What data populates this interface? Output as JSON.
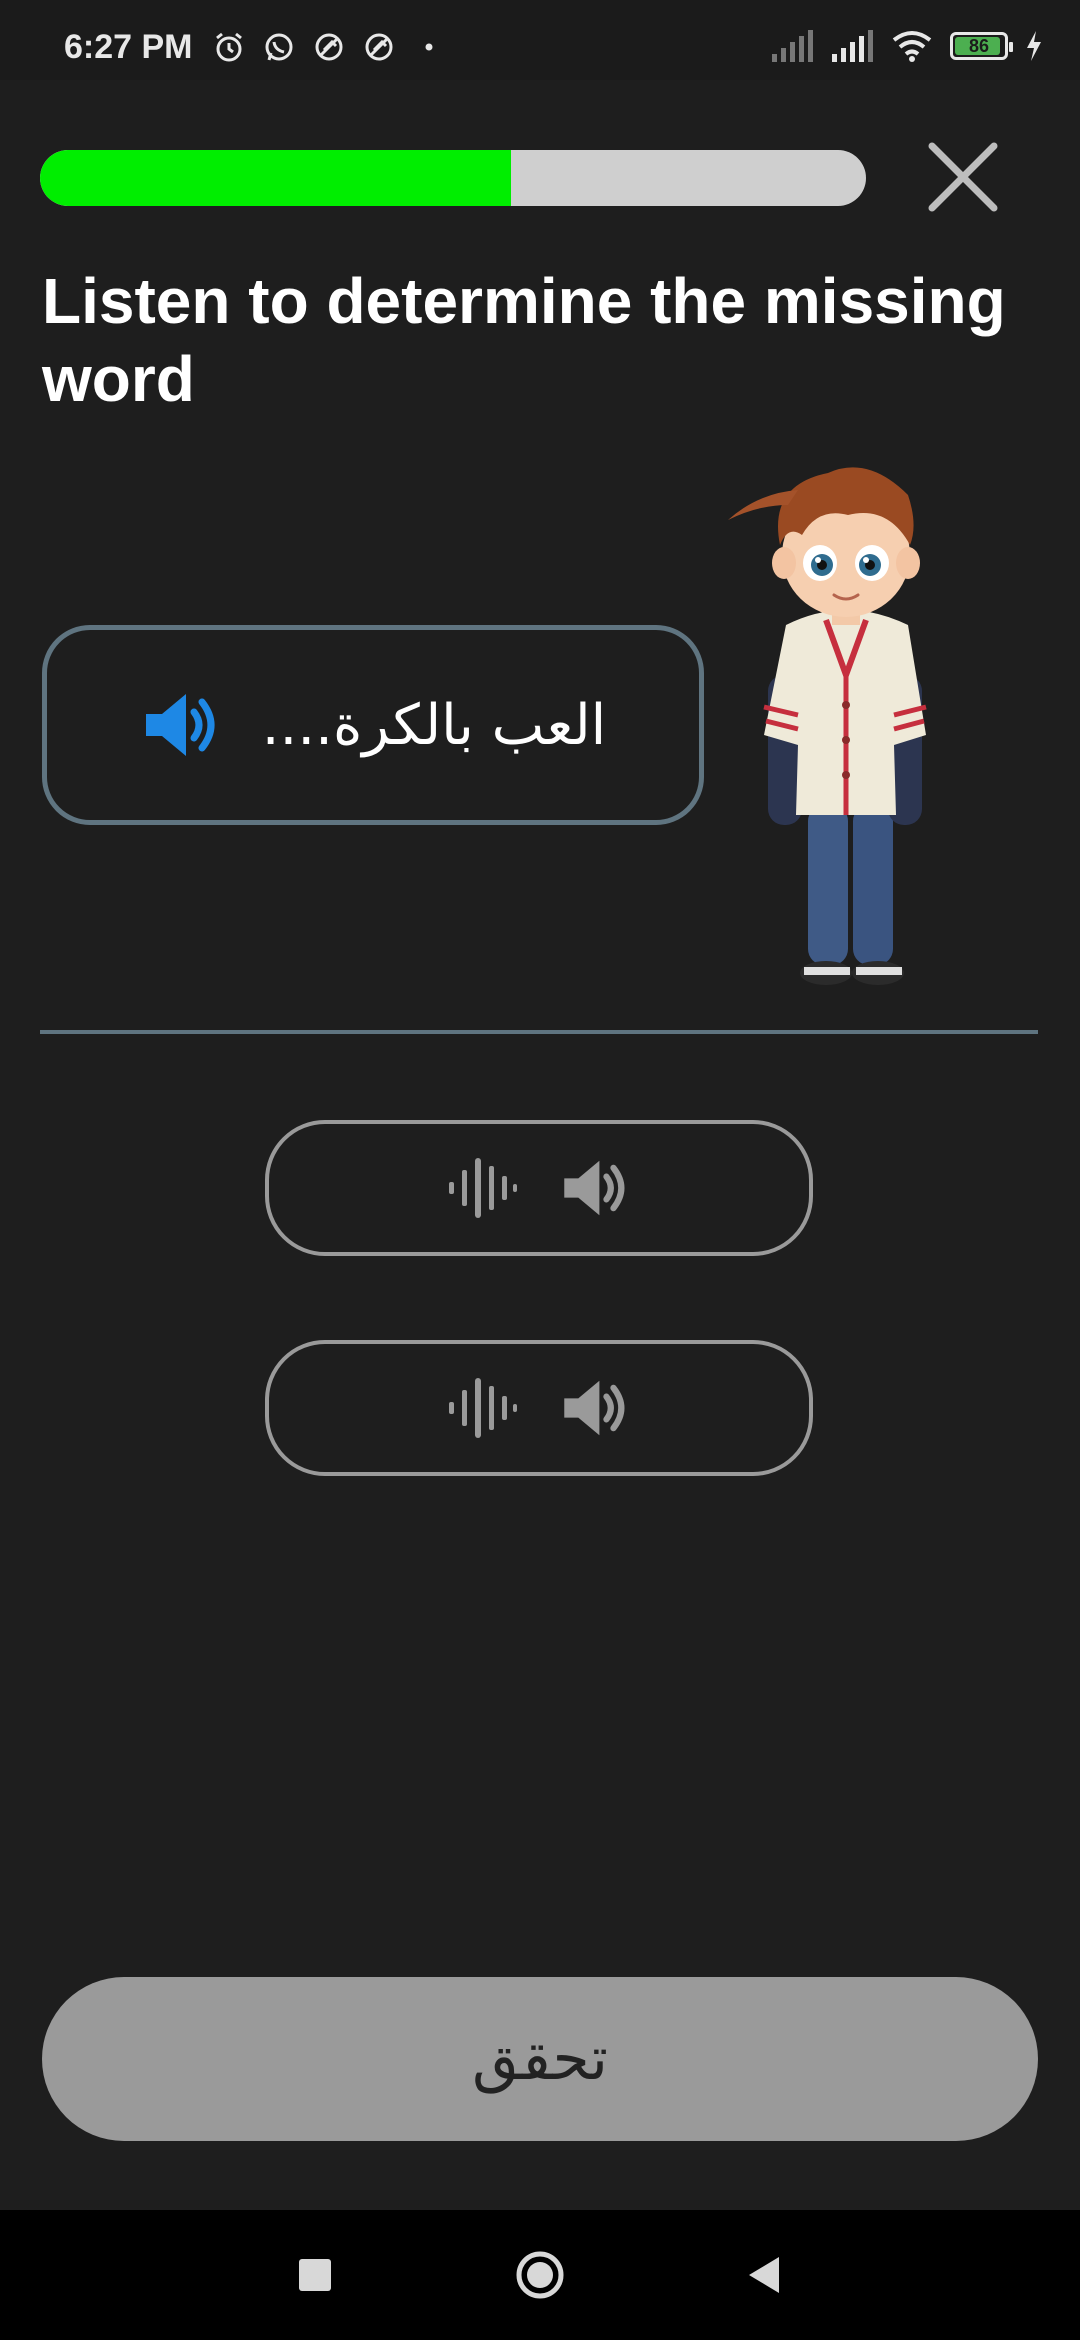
{
  "status_bar": {
    "time": "6:27 PM",
    "battery": "86",
    "left_icons": [
      "alarm-icon",
      "whatsapp-icon",
      "blocked-notification-icon",
      "blocked-notification-icon",
      "dot-icon"
    ],
    "right_icons": [
      "signal-icon",
      "signal-icon",
      "wifi-icon",
      "battery-icon",
      "charging-icon"
    ]
  },
  "progress": {
    "fraction": 0.57,
    "fill_color": "#00ee00",
    "track_color": "#cfcfcf"
  },
  "instruction": "Listen to determine the missing word",
  "prompt": {
    "text": "العب بالكرة....",
    "icon": "speaker-icon",
    "icon_color": "#1e88e5"
  },
  "options": [
    {
      "icons": [
        "audio-wave-icon",
        "speaker-icon"
      ]
    },
    {
      "icons": [
        "audio-wave-icon",
        "speaker-icon"
      ]
    }
  ],
  "check_button": {
    "label": "تحقق"
  },
  "nav_bar": {
    "icons": [
      "recents-square-icon",
      "home-circle-icon",
      "back-triangle-icon"
    ]
  }
}
